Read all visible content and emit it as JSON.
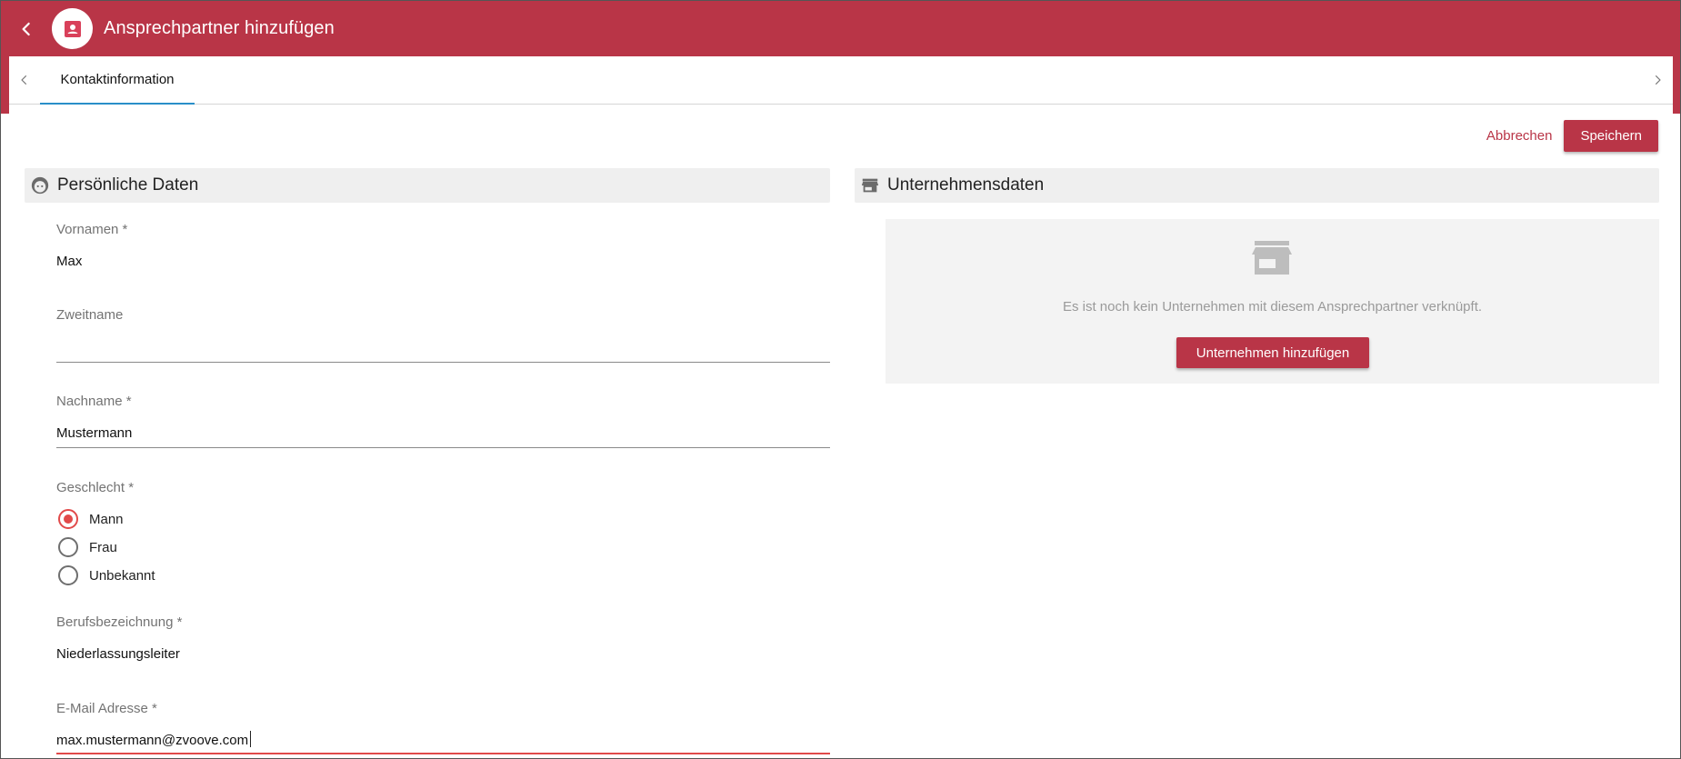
{
  "header": {
    "title": "Ansprechpartner hinzufügen",
    "bar_color": "#b93547"
  },
  "tabs": [
    {
      "label": "Kontaktinformation",
      "active": true
    }
  ],
  "actions": {
    "cancel_label": "Abbrechen",
    "save_label": "Speichern"
  },
  "personal": {
    "section_title": "Persönliche Daten",
    "first_name": {
      "label": "Vornamen *",
      "value": "Max"
    },
    "middle_name": {
      "label": "Zweitname",
      "value": ""
    },
    "last_name": {
      "label": "Nachname *",
      "value": "Mustermann"
    },
    "gender": {
      "label": "Geschlecht *",
      "options": [
        "Mann",
        "Frau",
        "Unbekannt"
      ],
      "selected": "Mann"
    },
    "job_title": {
      "label": "Berufsbezeichnung *",
      "value": "Niederlassungsleiter"
    },
    "email": {
      "label": "E-Mail Adresse *",
      "value": "max.mustermann@zvoove.com"
    }
  },
  "company": {
    "section_title": "Unternehmensdaten",
    "empty_text": "Es ist noch kein Unternehmen mit diesem Ansprechpartner verknüpft.",
    "add_label": "Unternehmen hinzufügen"
  },
  "icons": {
    "back": "chevron-left-icon",
    "avatar": "contact-card-icon",
    "tab_prev": "chevron-left-icon",
    "tab_next": "chevron-right-icon",
    "personal": "face-icon",
    "company": "store-icon"
  }
}
